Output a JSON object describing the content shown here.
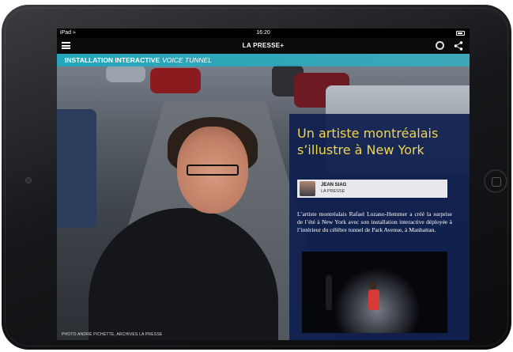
{
  "status": {
    "device": "iPad",
    "time": "16:20"
  },
  "app": {
    "brand": "LA PRESSE+"
  },
  "kicker": {
    "section": "INSTALLATION INTERACTIVE",
    "topic": "VOICE TUNNEL"
  },
  "article": {
    "headline": "Un artiste montréalais s’illustre à New York",
    "author_name": "JEAN SIAG",
    "author_org": "LA PRESSE",
    "lede": "L’artiste montréalais Rafael Lozano-Hemmer a créé la surprise de l’été à New York avec son installation interactive déployée à l’intérieur du célèbre tunnel de Park Avenue, à Manhattan."
  },
  "photo": {
    "credit": "PHOTO ANDRÉ PICHETTE, ARCHIVES LA PRESSE"
  },
  "icons": {
    "menu": "menu-icon",
    "audio": "headphones-icon",
    "share": "share-icon",
    "wifi": "wifi-icon",
    "battery": "battery-icon"
  },
  "colors": {
    "headline": "#f1d64c",
    "kicker_band": "#1fa8be",
    "panel": "#0e1e4e"
  }
}
